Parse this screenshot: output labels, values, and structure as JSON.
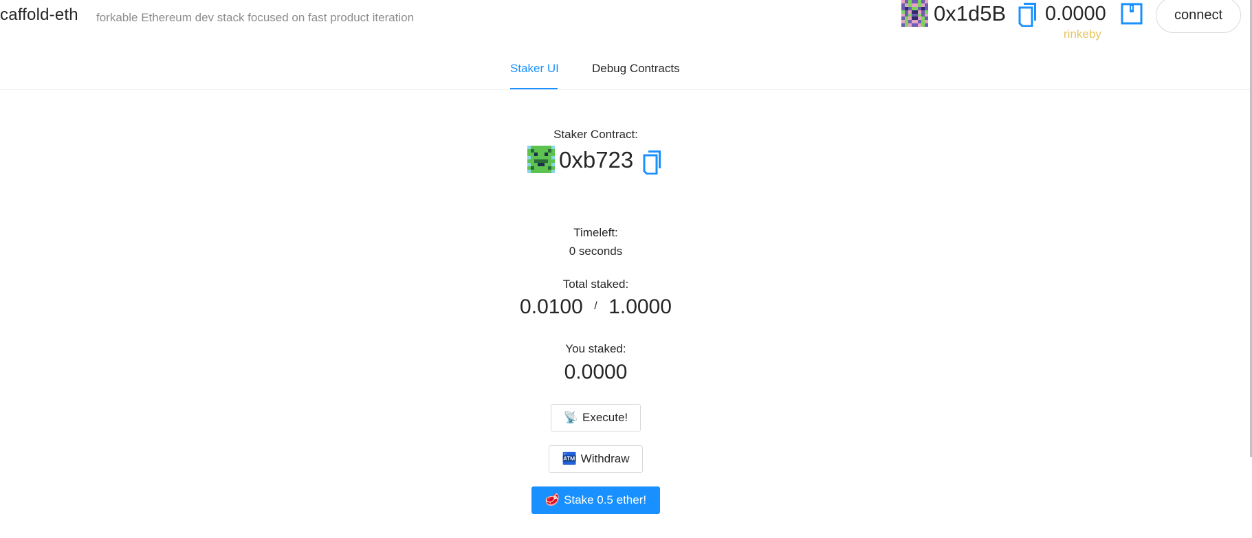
{
  "header": {
    "brand": "caffold-eth",
    "tagline": "forkable Ethereum dev stack focused on fast product iteration",
    "account": {
      "address": "0x1d5B",
      "balance": "0.0000",
      "network": "rinkeby",
      "network_color": "#e6c65d"
    },
    "connect_label": "connect"
  },
  "tabs": [
    {
      "label": "Staker UI",
      "active": true
    },
    {
      "label": "Debug Contracts",
      "active": false
    }
  ],
  "main": {
    "contract_label": "Staker Contract:",
    "contract_address": "0xb723",
    "timeleft_label": "Timeleft:",
    "timeleft_value": "0 seconds",
    "total_staked_label": "Total staked:",
    "total_staked": "0.0100",
    "threshold": "1.0000",
    "slash": "/",
    "you_staked_label": "You staked:",
    "you_staked": "0.0000"
  },
  "buttons": {
    "execute": {
      "icon": "📡",
      "label": "Execute!"
    },
    "withdraw": {
      "icon": "🏧",
      "label": "Withdraw"
    },
    "stake": {
      "icon": "🥩",
      "label": "Stake 0.5 ether!"
    }
  },
  "colors": {
    "accent": "#1890ff",
    "text": "#262626",
    "muted": "#8c8c8c"
  }
}
